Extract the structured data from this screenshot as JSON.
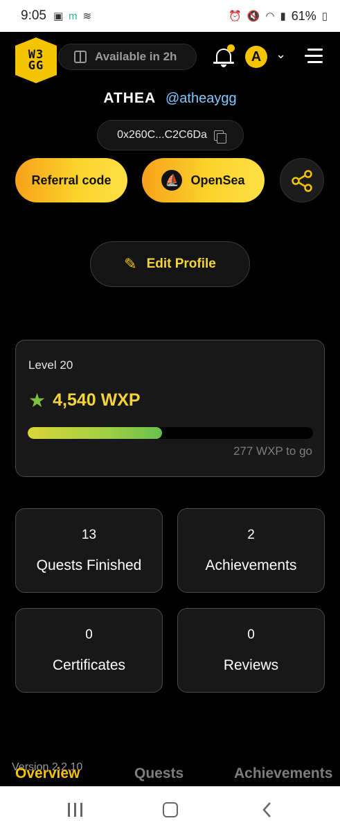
{
  "status_bar": {
    "time": "9:05",
    "battery": "61%"
  },
  "header": {
    "logo_text": "W3\nGG",
    "available_label": "Available in 2h",
    "avatar_letter": "A"
  },
  "profile": {
    "name": "ATHEA",
    "handle": "@atheaygg",
    "wallet": "0x260C...C2C6Da"
  },
  "actions": {
    "referral_label": "Referral code",
    "opensea_label": "OpenSea",
    "edit_label": "Edit Profile"
  },
  "level": {
    "label": "Level 20",
    "wxp": "4,540 WXP",
    "progress": 0.47,
    "to_go": "277 WXP to go"
  },
  "stats": [
    {
      "value": "13",
      "label": "Quests Finished"
    },
    {
      "value": "2",
      "label": "Achievements"
    },
    {
      "value": "0",
      "label": "Certificates"
    },
    {
      "value": "0",
      "label": "Reviews"
    }
  ],
  "footer": {
    "version": "Version 2.2.10",
    "tabs": [
      "Overview",
      "Quests",
      "Achievements"
    ]
  },
  "colors": {
    "accent": "#f5c400",
    "handle": "#7fc9ff",
    "progress_end": "#68c04d"
  }
}
